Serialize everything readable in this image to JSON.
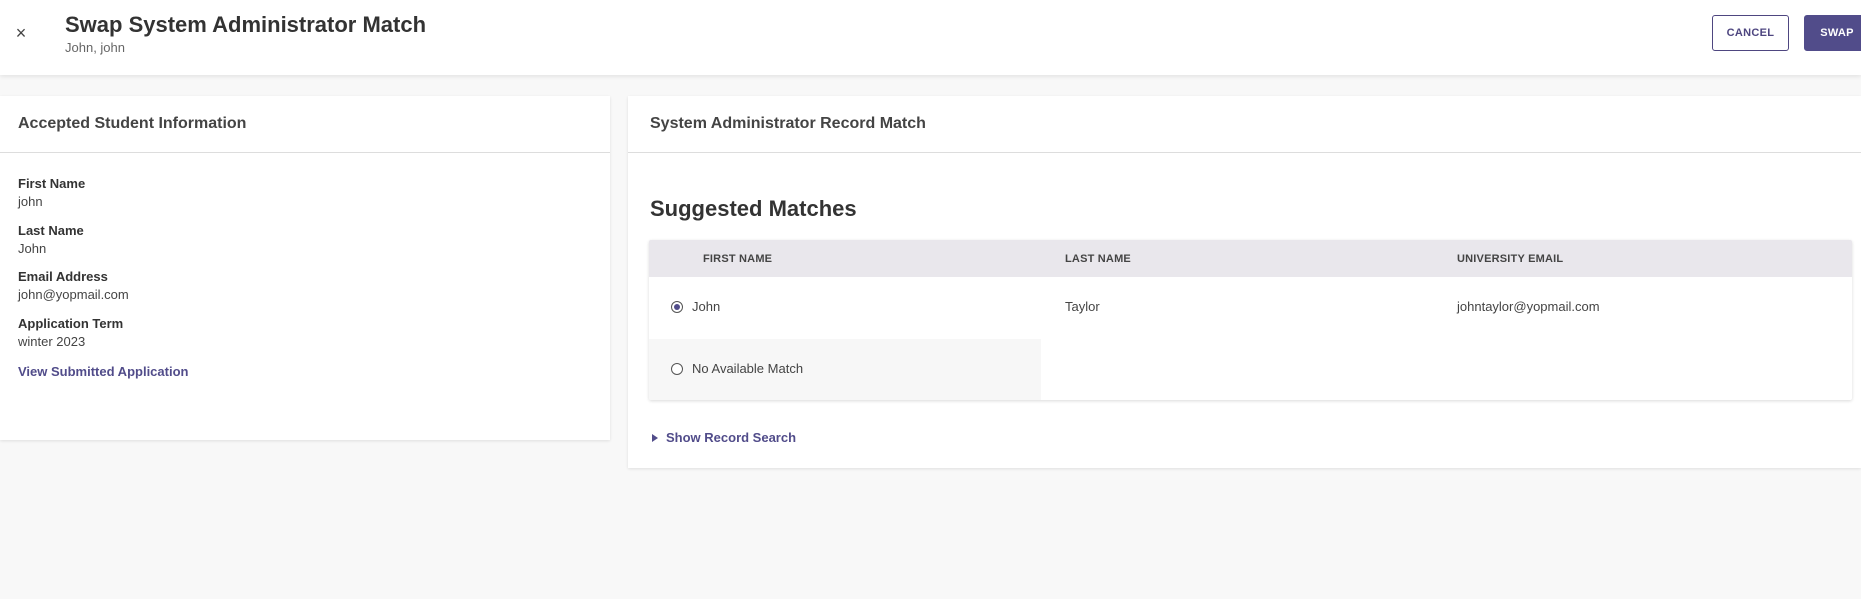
{
  "header": {
    "title": "Swap System Administrator Match",
    "subtitle": "John, john",
    "cancel_label": "CANCEL",
    "swap_label": "SWAP",
    "close_glyph": "×"
  },
  "student_card": {
    "title": "Accepted Student Information",
    "fields": [
      {
        "label": "First Name",
        "value": "john"
      },
      {
        "label": "Last Name",
        "value": "John"
      },
      {
        "label": "Email Address",
        "value": "john@yopmail.com"
      },
      {
        "label": "Application Term",
        "value": "winter 2023"
      }
    ],
    "link_label": "View Submitted Application"
  },
  "match_card": {
    "title": "System Administrator Record Match",
    "section_title": "Suggested Matches",
    "columns": [
      "FIRST NAME",
      "LAST NAME",
      "UNIVERSITY EMAIL"
    ],
    "rows": [
      {
        "first_name": "John",
        "last_name": "Taylor",
        "email": "johntaylor@yopmail.com",
        "selected": true
      },
      {
        "first_name": "No Available Match",
        "last_name": "",
        "email": "",
        "selected": false
      }
    ],
    "show_search_label": "Show Record Search"
  },
  "colors": {
    "accent": "#514c8a",
    "table_header_bg": "#e9e7ec",
    "page_bg": "#f8f8f8"
  }
}
